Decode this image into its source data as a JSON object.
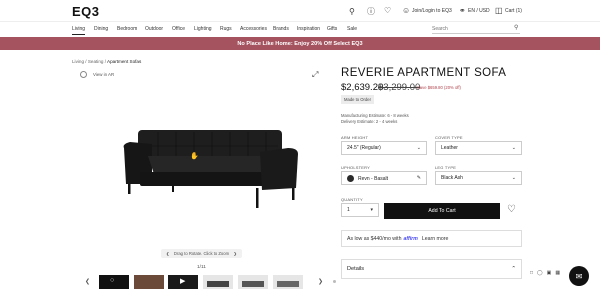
{
  "header": {
    "logo": "EQ3",
    "login": "Join/Login to EQ3",
    "locale": "EN / USD",
    "cart": "Cart (1)"
  },
  "nav": {
    "items": [
      "Living",
      "Dining",
      "Bedroom",
      "Outdoor",
      "Office",
      "Lighting",
      "Rugs",
      "Accessories",
      "Brands",
      "Inspiration",
      "Gifts",
      "Sale"
    ],
    "active": "Living",
    "search_placeholder": "Search"
  },
  "promo": {
    "text": "No Place Like Home: Enjoy 20% Off Select EQ3"
  },
  "breadcrumb": {
    "items": [
      "Living",
      "Seating"
    ],
    "current": "Apartment Sofas",
    "sep": "/"
  },
  "gallery": {
    "view_all": "View in AR",
    "rotate_hint": "Drag to Rotate. Click to Zoom",
    "counter": "1/11"
  },
  "product": {
    "title": "REVERIE APARTMENT SOFA",
    "price": "$2,639.20",
    "compare_price": "$3,299.00",
    "save_text": "Save $659.80 (20% off)",
    "badge": "Made to Order",
    "manufacturing": "Manufacturing Estimate: 6 - 8 weeks",
    "delivery": "Delivery Estimate: 2 - 4 weeks",
    "options": {
      "arm_height": {
        "label": "ARM HEIGHT",
        "value": "24.5\" (Regular)"
      },
      "cover_type": {
        "label": "COVER TYPE",
        "value": "Leather"
      },
      "upholstery": {
        "label": "UPHOLSTERY",
        "value": "Revn - Basalt"
      },
      "leg_type": {
        "label": "LEG TYPE",
        "value": "Black Ash"
      },
      "quantity": {
        "label": "QUANTITY",
        "value": "1"
      }
    },
    "add_to_cart": "Add To Cart",
    "affirm": {
      "prefix": "As low as $440/mo with",
      "brand": "affirm",
      "learn_more": "Learn more"
    },
    "details": "Details"
  },
  "colors": {
    "promo_bg": "#a4535f",
    "button_bg": "#111111",
    "sofa": "#1c1c1c"
  }
}
